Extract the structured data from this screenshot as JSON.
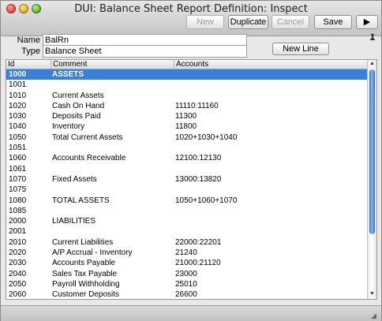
{
  "window": {
    "title": "DUI: Balance Sheet Report Definition: Inspect"
  },
  "toolbar": {
    "new_label": "New",
    "duplicate_label": "Duplicate",
    "cancel_label": "Cancel",
    "save_label": "Save",
    "next_label": "▶"
  },
  "form": {
    "name_label": "Name",
    "name_value": "BalRn",
    "type_label": "Type",
    "type_value": "Balance Sheet",
    "new_line_label": "New Line"
  },
  "table": {
    "columns": [
      "Id",
      "Comment",
      "Accounts"
    ],
    "rows": [
      {
        "id": "1000",
        "comment": "ASSETS",
        "accounts": ""
      },
      {
        "id": "1001",
        "comment": "",
        "accounts": ""
      },
      {
        "id": "1010",
        "comment": "Current Assets",
        "accounts": ""
      },
      {
        "id": "1020",
        "comment": "Cash On Hand",
        "accounts": "11110:11160"
      },
      {
        "id": "1030",
        "comment": "Deposits Paid",
        "accounts": "11300"
      },
      {
        "id": "1040",
        "comment": "Inventory",
        "accounts": "11800"
      },
      {
        "id": "1050",
        "comment": "Total Current Assets",
        "accounts": "1020+1030+1040"
      },
      {
        "id": "1051",
        "comment": "",
        "accounts": ""
      },
      {
        "id": "1060",
        "comment": "Accounts Receivable",
        "accounts": "12100:12130"
      },
      {
        "id": "1061",
        "comment": "",
        "accounts": ""
      },
      {
        "id": "1070",
        "comment": "Fixed Assets",
        "accounts": "13000:13820"
      },
      {
        "id": "1075",
        "comment": "",
        "accounts": ""
      },
      {
        "id": "1080",
        "comment": "TOTAL ASSETS",
        "accounts": "1050+1060+1070"
      },
      {
        "id": "1085",
        "comment": "",
        "accounts": ""
      },
      {
        "id": "2000",
        "comment": "LIABILITIES",
        "accounts": ""
      },
      {
        "id": "2001",
        "comment": "",
        "accounts": ""
      },
      {
        "id": "2010",
        "comment": "Current Liabilities",
        "accounts": "22000:22201"
      },
      {
        "id": "2020",
        "comment": "A/P Accrual - Inventory",
        "accounts": "21240"
      },
      {
        "id": "2030",
        "comment": "Accounts Payable",
        "accounts": "21000:21120"
      },
      {
        "id": "2040",
        "comment": "Sales Tax Payable",
        "accounts": "23000"
      },
      {
        "id": "2050",
        "comment": "Payroll Withholding",
        "accounts": "25010"
      },
      {
        "id": "2060",
        "comment": "Customer Deposits",
        "accounts": "26600"
      }
    ]
  },
  "colors": {
    "selection": "#3b7fd6"
  },
  "icons": {
    "pin": "pin-icon",
    "scroll_up": "arrow-up-icon",
    "scroll_down": "arrow-down-icon"
  }
}
